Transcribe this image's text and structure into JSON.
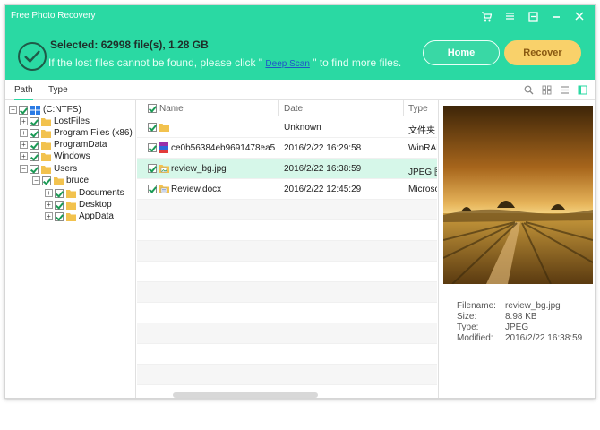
{
  "app": {
    "title": "Free Photo Recovery"
  },
  "window_controls": [
    {
      "name": "cart-icon"
    },
    {
      "name": "menu-icon"
    },
    {
      "name": "settings-icon"
    },
    {
      "name": "minimize-icon"
    },
    {
      "name": "close-icon"
    }
  ],
  "header": {
    "selected_text": "Selected: 62998 file(s), 1.28 GB",
    "hint_before": "If the lost files cannot be found, please click \" ",
    "hint_link": "Deep Scan",
    "hint_after": " \" to find more files.",
    "home_label": "Home",
    "recover_label": "Recover"
  },
  "tabs": {
    "path_label": "Path",
    "type_label": "Type"
  },
  "tree": [
    {
      "label": "(C:NTFS)",
      "level": 0,
      "icon": "drive-icon"
    },
    {
      "label": "LostFiles",
      "level": 1,
      "icon": "folder-icon"
    },
    {
      "label": "Program Files (x86)",
      "level": 1,
      "icon": "folder-icon"
    },
    {
      "label": "ProgramData",
      "level": 1,
      "icon": "folder-icon"
    },
    {
      "label": "Windows",
      "level": 1,
      "icon": "folder-icon"
    },
    {
      "label": "Users",
      "level": 1,
      "icon": "folder-icon"
    },
    {
      "label": "bruce",
      "level": 2,
      "icon": "folder-icon"
    },
    {
      "label": "Documents",
      "level": 3,
      "icon": "folder-icon"
    },
    {
      "label": "Desktop",
      "level": 3,
      "icon": "folder-icon"
    },
    {
      "label": "AppData",
      "level": 3,
      "icon": "folder-icon"
    }
  ],
  "list": {
    "columns": {
      "name": "Name",
      "date": "Date",
      "type": "Type"
    },
    "rows": [
      {
        "name": "",
        "date": "Unknown",
        "type": "文件夹",
        "icon": "folder-icon"
      },
      {
        "name": "ce0b56384eb9691478ea5...",
        "date": "2016/2/22 16:29:58",
        "type": "WinRAR",
        "icon": "winrar-icon"
      },
      {
        "name": "review_bg.jpg",
        "date": "2016/2/22 16:38:59",
        "type": "JPEG 图",
        "icon": "jpeg-icon",
        "selected": true
      },
      {
        "name": "Review.docx",
        "date": "2016/2/22 12:45:29",
        "type": "Microso",
        "icon": "docx-icon"
      }
    ]
  },
  "preview": {
    "filename_label": "Filename:",
    "filename": "review_bg.jpg",
    "size_label": "Size:",
    "size": "8.98 KB",
    "type_label": "Type:",
    "type": "JPEG",
    "modified_label": "Modified:",
    "modified": "2016/2/22 16:38:59"
  },
  "colors": {
    "accent": "#2ad9a3",
    "recover": "#f9d16a",
    "selected_row": "#d6f7e9"
  }
}
